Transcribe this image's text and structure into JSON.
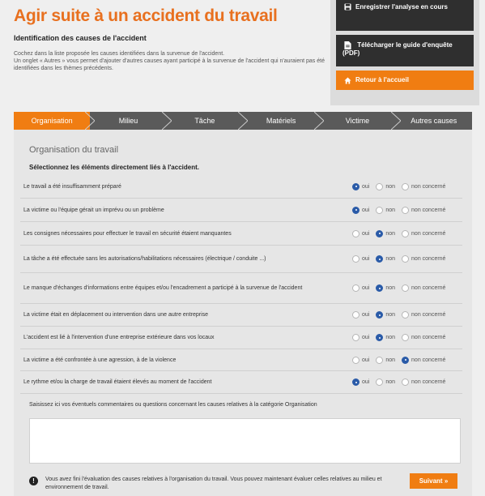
{
  "header": {
    "title": "Agir suite à un accident du travail",
    "subtitle": "Identification des causes de l'accident",
    "intro_line1": "Cochez dans la liste proposée les causes identifiées dans la survenue de l'accident.",
    "intro_line2": "Un onglet « Autres » vous permet d'ajouter d'autres causes ayant participé à la survenue de l'accident qui n'auraient pas été identifiées dans les thèmes précédents."
  },
  "side": {
    "save": "Enregistrer l'analyse en cours",
    "download": "Télécharger le guide d'enquête (PDF)",
    "home": "Retour à l'accueil"
  },
  "tabs": [
    {
      "label": "Organisation",
      "active": true
    },
    {
      "label": "Milieu",
      "active": false
    },
    {
      "label": "Tâche",
      "active": false
    },
    {
      "label": "Matériels",
      "active": false
    },
    {
      "label": "Victime",
      "active": false
    },
    {
      "label": "Autres causes",
      "active": false
    }
  ],
  "section": {
    "title": "Organisation du travail",
    "instruction": "Sélectionnez les éléments directement liés à l'accident."
  },
  "options": {
    "oui": "oui",
    "non": "non",
    "nc": "non concerné"
  },
  "questions": [
    {
      "text": "Le travail a été insuffisamment préparé",
      "selected": "oui"
    },
    {
      "text": "La victime ou l'équipe gérait un imprévu ou un problème",
      "selected": "oui"
    },
    {
      "text": "Les consignes nécessaires pour effectuer le travail en sécurité étaient manquantes",
      "selected": "non"
    },
    {
      "text": "La tâche a été effectuée sans les autorisations/habilitations nécessaires (électrique / conduite ...)",
      "selected": "non"
    },
    {
      "text": "Le manque d'échanges d'informations entre équipes et/ou l'encadrement a participé à la survenue de l'accident",
      "selected": "non"
    },
    {
      "text": "La victime était en déplacement ou intervention dans une autre entreprise",
      "selected": "non"
    },
    {
      "text": "L'accident est lié à l'intervention d'une entreprise extérieure dans vos locaux",
      "selected": "non"
    },
    {
      "text": "La victime a été confrontée à une agression, à de la violence",
      "selected": "nc"
    },
    {
      "text": "Le rythme et/ou la charge de travail étaient élevés au moment de l'accident",
      "selected": "oui"
    }
  ],
  "comment": {
    "label": "Saisissez ici vos éventuels commentaires ou questions concernant les causes relatives à la catégorie Organisation",
    "value": ""
  },
  "footer": {
    "info": "Vous avez fini l'évaluation des causes relatives à l'organisation du travail. Vous pouvez maintenant évaluer celles relatives au milieu et environnement de travail.",
    "next": "Suivant »"
  },
  "colors": {
    "accent": "#f07d12",
    "title": "#e8701f",
    "dark": "#2f2f2f",
    "radio": "#2a5ba8"
  },
  "icons": {
    "save": "floppy-disk-icon",
    "download": "pdf-file-icon",
    "home": "home-icon",
    "info": "info-icon"
  }
}
